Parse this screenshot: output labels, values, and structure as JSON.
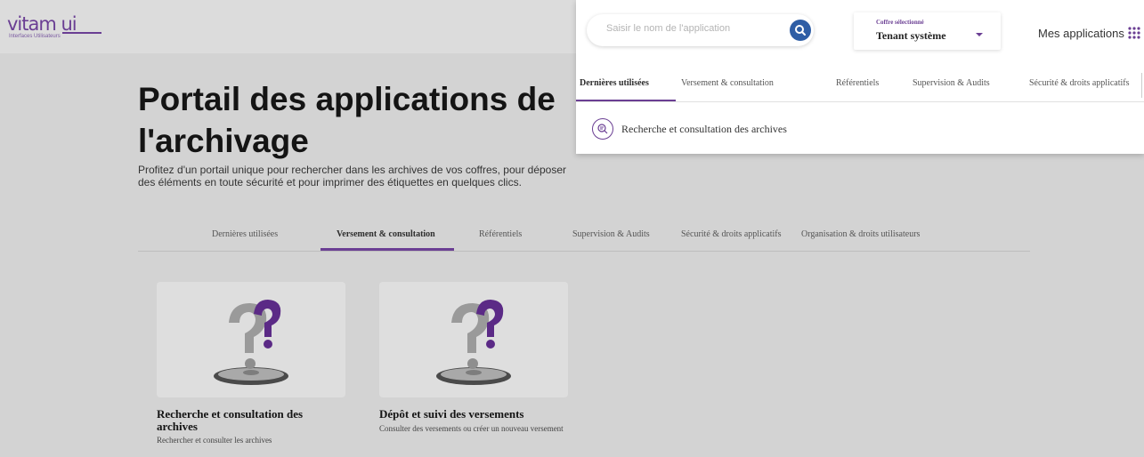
{
  "logo": {
    "text": "vitam ui",
    "subtitle": "Interfaces Utilisateurs"
  },
  "page": {
    "title": "Portail des applications de l'archivage",
    "description": "Profitez d'un portail unique pour rechercher dans les archives de vos coffres, pour déposer des éléments en toute sécurité et pour imprimer des étiquettes en quelques clics."
  },
  "tabs": [
    {
      "label": "Dernières utilisées"
    },
    {
      "label": "Versement & consultation"
    },
    {
      "label": "Référentiels"
    },
    {
      "label": "Supervision & Audits"
    },
    {
      "label": "Sécurité & droits applicatifs"
    },
    {
      "label": "Organisation & droits utilisateurs"
    }
  ],
  "cards": [
    {
      "title": "Recherche et consultation des archives",
      "description": "Rechercher et consulter les archives",
      "icon": "question-mark-pedestal-icon"
    },
    {
      "title": "Dépôt et suivi des versements",
      "description": "Consulter des versements ou créer un nouveau versement",
      "icon": "question-mark-pedestal-icon"
    }
  ],
  "overlay": {
    "search": {
      "placeholder": "Saisir le nom de l'application",
      "value": ""
    },
    "tenant": {
      "label": "Coffre sélectionné",
      "value": "Tenant système"
    },
    "my_apps_label": "Mes applications",
    "tabs": [
      {
        "label": "Dernières utilisées"
      },
      {
        "label": "Versement & consultation"
      },
      {
        "label": "Référentiels"
      },
      {
        "label": "Supervision & Audits"
      },
      {
        "label": "Sécurité & droits applicatifs"
      }
    ],
    "recent_item": {
      "label": "Recherche et consultation des archives",
      "icon": "archive-search-icon"
    }
  },
  "colors": {
    "accent": "#6a3e93",
    "search_button": "#2f5ea5",
    "backdrop": "#d3d3d3"
  }
}
